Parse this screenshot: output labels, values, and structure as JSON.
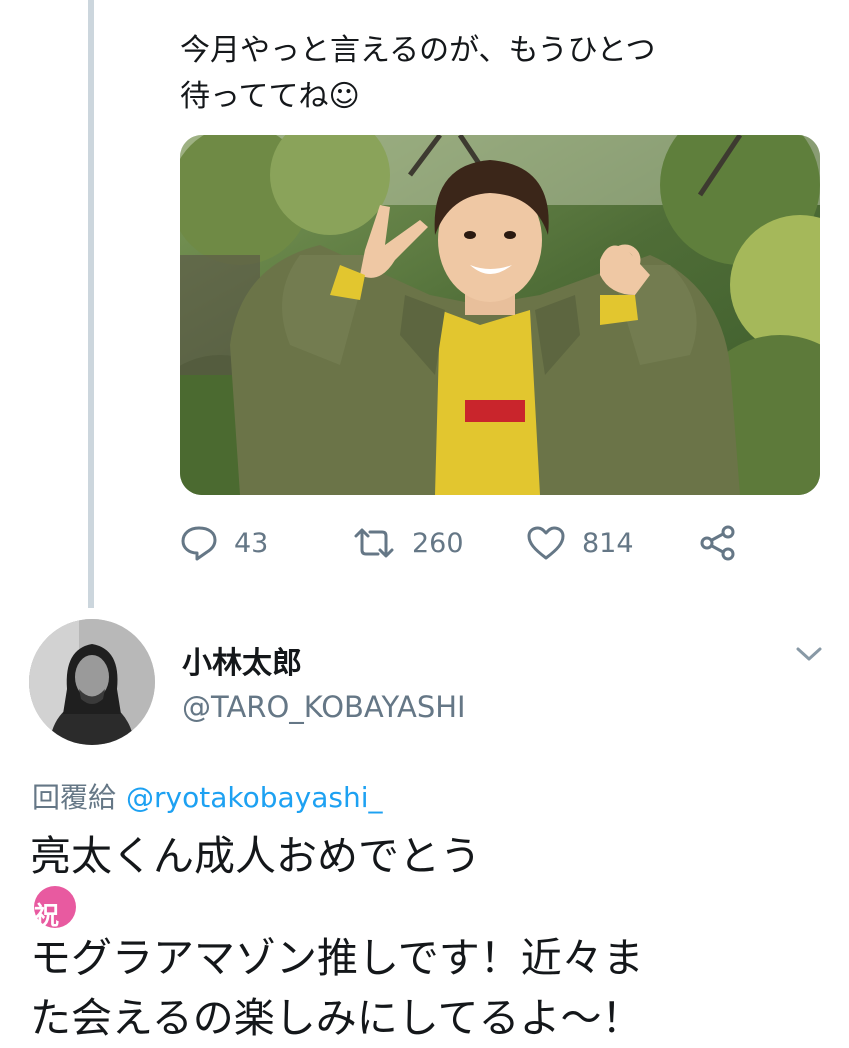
{
  "prev_tweet": {
    "text_line1": "今月やっと言えるのが、もうひとつ",
    "text_line2": "待っててね☺",
    "actions": {
      "reply": {
        "icon": "reply-icon",
        "count": "43"
      },
      "retweet": {
        "icon": "retweet-icon",
        "count": "260"
      },
      "like": {
        "icon": "heart-icon",
        "count": "814"
      },
      "share": {
        "icon": "share-icon"
      }
    }
  },
  "reply_tweet": {
    "display_name": "小林太郎",
    "handle": "@TARO_KOBAYASHI",
    "reply_prefix": "回覆給",
    "reply_mention": "@ryotakobayashi_",
    "body_line1": "亮太くん成人おめでとう",
    "emoji_badge": "祝",
    "body_line2": "モグラアマゾン推しです！近々ま",
    "body_line3": "た会えるの楽しみにしてるよ〜！"
  },
  "colors": {
    "text": "#14171a",
    "secondary": "#657786",
    "accent": "#1da1f2",
    "thread_line": "#ccd6dd",
    "badge": "#e85aa0"
  }
}
